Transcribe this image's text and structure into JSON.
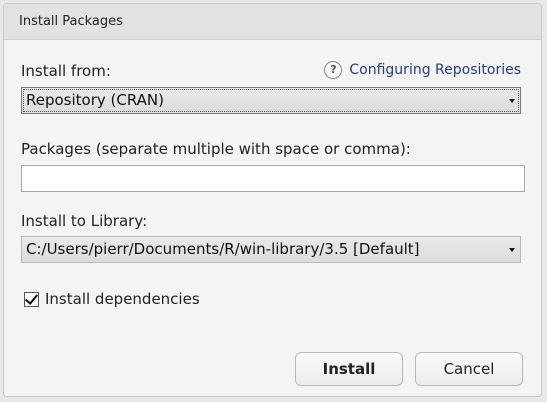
{
  "window": {
    "title": "Install Packages"
  },
  "install_from": {
    "label": "Install from:",
    "selected": "Repository (CRAN)",
    "help_link": "Configuring Repositories",
    "help_icon": "question-icon"
  },
  "packages": {
    "label": "Packages (separate multiple with space or comma):",
    "value": ""
  },
  "library": {
    "label": "Install to Library:",
    "selected": "C:/Users/pierr/Documents/R/win-library/3.5 [Default]"
  },
  "dependencies": {
    "label": "Install dependencies",
    "checked": true
  },
  "buttons": {
    "install": "Install",
    "cancel": "Cancel"
  }
}
